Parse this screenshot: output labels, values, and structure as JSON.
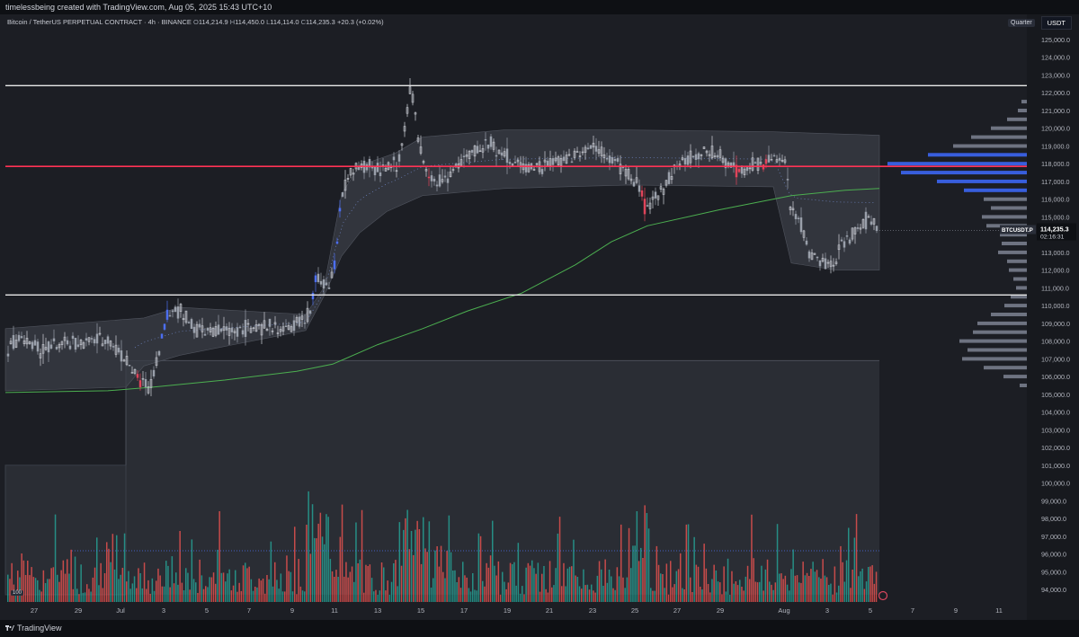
{
  "header": {
    "creator_text": "timelessbeing created with TradingView.com, Aug 05, 2025 15:43 UTC+10"
  },
  "legend": {
    "symbol_text": "Bitcoin / TetherUS PERPETUAL CONTRACT · 4h · BINANCE",
    "open_label": "O",
    "open_value": "114,214.9",
    "high_label": "H",
    "high_value": "114,450.0",
    "low_label": "L",
    "low_value": "114,114.0",
    "close_label": "C",
    "close_value": "114,235.3",
    "change_value": "+20.3 (+0.02%)"
  },
  "toolbar": {
    "range_button": "Quarter",
    "currency_label": "USDT"
  },
  "price_tag": {
    "symbol": "BTCUSDT.P",
    "price": "114,235.3",
    "countdown": "02:16:31"
  },
  "volume_badge": "100",
  "footer": {
    "brand": "TradingView"
  },
  "colors": {
    "background": "#1c1e24",
    "bull": "#d1d4dc",
    "bear": "#e0455a",
    "impulse": "#4d6ff0",
    "vol_up": "#26a69a",
    "vol_down": "#ef5350",
    "ma_line": "#4caf50",
    "level_line": "#e8e8e8",
    "key_level": "#ff3355"
  },
  "chart_data": {
    "type": "candlestick",
    "interval": "4h",
    "ylim": [
      93500,
      125500
    ],
    "y_ticks": [
      94000,
      95000,
      96000,
      97000,
      98000,
      99000,
      100000,
      101000,
      102000,
      103000,
      104000,
      105000,
      106000,
      107000,
      108000,
      109000,
      110000,
      111000,
      112000,
      113000,
      114000,
      115000,
      116000,
      117000,
      118000,
      119000,
      120000,
      121000,
      122000,
      123000,
      124000,
      125000
    ],
    "x_tick_labels": [
      "27",
      "29",
      "Jul",
      "3",
      "5",
      "7",
      "9",
      "11",
      "13",
      "15",
      "17",
      "19",
      "21",
      "23",
      "25",
      "27",
      "29",
      "Aug",
      "3",
      "5",
      "7",
      "9",
      "11"
    ],
    "x_tick_positions": [
      38,
      87,
      134,
      182,
      230,
      277,
      325,
      372,
      420,
      468,
      516,
      564,
      611,
      659,
      706,
      753,
      801,
      872,
      920,
      968,
      1015,
      1063,
      1111
    ],
    "horizontal_levels": [
      {
        "price": 122400,
        "color": "#e8e8e8"
      },
      {
        "price": 117850,
        "color": "#ff3355"
      },
      {
        "price": 110600,
        "color": "#e8e8e8"
      }
    ],
    "price_path": [
      [
        6,
        107400
      ],
      [
        20,
        108200
      ],
      [
        45,
        107500
      ],
      [
        70,
        107800
      ],
      [
        100,
        108000
      ],
      [
        120,
        108100
      ],
      [
        140,
        106900
      ],
      [
        155,
        105700
      ],
      [
        165,
        105500
      ],
      [
        178,
        107800
      ],
      [
        185,
        109600
      ],
      [
        200,
        109800
      ],
      [
        215,
        108700
      ],
      [
        240,
        108500
      ],
      [
        270,
        108700
      ],
      [
        300,
        108800
      ],
      [
        320,
        108600
      ],
      [
        345,
        109600
      ],
      [
        350,
        111500
      ],
      [
        365,
        111000
      ],
      [
        372,
        112500
      ],
      [
        378,
        116000
      ],
      [
        385,
        117000
      ],
      [
        395,
        117800
      ],
      [
        420,
        117700
      ],
      [
        440,
        118000
      ],
      [
        448,
        119500
      ],
      [
        456,
        122400
      ],
      [
        465,
        119000
      ],
      [
        475,
        117600
      ],
      [
        485,
        116800
      ],
      [
        500,
        117500
      ],
      [
        520,
        118500
      ],
      [
        545,
        119200
      ],
      [
        570,
        118000
      ],
      [
        600,
        117800
      ],
      [
        630,
        118300
      ],
      [
        660,
        119100
      ],
      [
        690,
        117800
      ],
      [
        712,
        116500
      ],
      [
        718,
        115200
      ],
      [
        730,
        116200
      ],
      [
        750,
        117800
      ],
      [
        780,
        118700
      ],
      [
        800,
        118400
      ],
      [
        820,
        117600
      ],
      [
        840,
        117900
      ],
      [
        860,
        118400
      ],
      [
        872,
        117900
      ],
      [
        878,
        115600
      ],
      [
        890,
        114600
      ],
      [
        900,
        112800
      ],
      [
        915,
        112400
      ],
      [
        925,
        112100
      ],
      [
        935,
        113500
      ],
      [
        950,
        114200
      ],
      [
        965,
        114900
      ],
      [
        978,
        114235
      ]
    ],
    "lower_band": [
      [
        6,
        105200
      ],
      [
        140,
        105400
      ],
      [
        160,
        106600
      ],
      [
        200,
        107200
      ],
      [
        340,
        108600
      ],
      [
        360,
        110500
      ],
      [
        380,
        112800
      ],
      [
        400,
        114100
      ],
      [
        430,
        115300
      ],
      [
        470,
        116200
      ],
      [
        560,
        116600
      ],
      [
        700,
        116800
      ],
      [
        860,
        116700
      ],
      [
        880,
        112400
      ],
      [
        930,
        112000
      ],
      [
        978,
        112000
      ]
    ],
    "upper_band": [
      [
        6,
        108700
      ],
      [
        160,
        109300
      ],
      [
        200,
        109900
      ],
      [
        340,
        109500
      ],
      [
        360,
        111000
      ],
      [
        380,
        116300
      ],
      [
        400,
        117900
      ],
      [
        440,
        118600
      ],
      [
        470,
        119500
      ],
      [
        560,
        119900
      ],
      [
        700,
        119900
      ],
      [
        860,
        119800
      ],
      [
        978,
        119600
      ]
    ],
    "ma_line": [
      [
        6,
        105100
      ],
      [
        120,
        105200
      ],
      [
        170,
        105400
      ],
      [
        250,
        105800
      ],
      [
        330,
        106300
      ],
      [
        370,
        106700
      ],
      [
        420,
        107800
      ],
      [
        470,
        108700
      ],
      [
        520,
        109700
      ],
      [
        580,
        110700
      ],
      [
        640,
        112300
      ],
      [
        680,
        113600
      ],
      [
        720,
        114500
      ],
      [
        800,
        115400
      ],
      [
        880,
        116200
      ],
      [
        940,
        116500
      ],
      [
        978,
        116600
      ]
    ],
    "value_area_box": {
      "x_start": 140,
      "x_end": 978,
      "price_low": 93700,
      "price_high": 106900
    },
    "left_box": {
      "x_start": 6,
      "x_end": 140,
      "price_low": 93700,
      "price_high": 101000
    },
    "volume_profile": [
      [
        121500,
        6
      ],
      [
        121000,
        10
      ],
      [
        120500,
        22
      ],
      [
        120000,
        40
      ],
      [
        119500,
        62
      ],
      [
        119000,
        82
      ],
      [
        118500,
        110
      ],
      [
        118000,
        155
      ],
      [
        117500,
        140
      ],
      [
        117000,
        100
      ],
      [
        116500,
        70
      ],
      [
        116000,
        48
      ],
      [
        115500,
        40
      ],
      [
        115000,
        50
      ],
      [
        114500,
        45
      ],
      [
        114000,
        30
      ],
      [
        113500,
        28
      ],
      [
        113000,
        32
      ],
      [
        112500,
        22
      ],
      [
        112000,
        20
      ],
      [
        111500,
        15
      ],
      [
        111000,
        12
      ],
      [
        110500,
        18
      ],
      [
        110000,
        25
      ],
      [
        109500,
        40
      ],
      [
        109000,
        55
      ],
      [
        108500,
        60
      ],
      [
        108000,
        75
      ],
      [
        107500,
        66
      ],
      [
        107000,
        72
      ],
      [
        106500,
        48
      ],
      [
        106000,
        26
      ],
      [
        105500,
        8
      ]
    ]
  }
}
